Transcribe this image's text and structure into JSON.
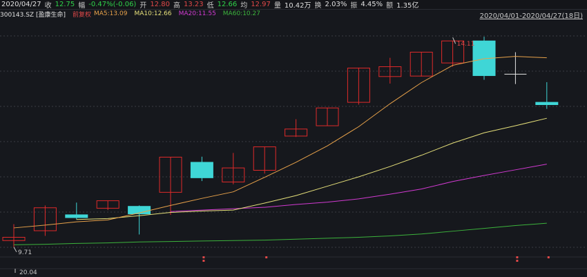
{
  "header": {
    "date": "2020/04/27",
    "close_label": "收",
    "close_value": "12.75",
    "change_label": "幅",
    "change_value": "-0.47%(-0.06)",
    "open_label": "开",
    "open_value": "12.80",
    "high_label": "高",
    "high_value": "13.23",
    "low_label": "低",
    "low_value": "12.66",
    "avg_label": "均",
    "avg_value": "12.97",
    "volume_label": "量",
    "volume_value": "10.42万",
    "turnover_label": "换",
    "turnover_value": "2.03%",
    "amplitude_label": "振",
    "amplitude_value": "4.45%",
    "amount_label": "额",
    "amount_value": "1.35亿",
    "range": "2020/04/01-2020/04/27(18日)"
  },
  "legend": {
    "stock": "300143.SZ [盈康生命]",
    "adjust": "前复权",
    "ma5": "MA5:13.09",
    "ma10": "MA10:12.66",
    "ma20": "MA20:11.55",
    "ma60": "MA60:10.27"
  },
  "colors": {
    "up": "#e02a2a",
    "down": "#3fd6d6",
    "ma5": "#e8a24a",
    "ma10": "#e6e07a",
    "ma20": "#d23ad2",
    "ma60": "#3cb43c",
    "grid": "#3a3d44"
  },
  "chart_data": {
    "type": "candlestick",
    "categories": [
      "20.04"
    ],
    "ylim": [
      9.5,
      14.6
    ],
    "candles": [
      {
        "open": 9.85,
        "close": 9.92,
        "high": 10.2,
        "low": 9.71
      },
      {
        "open": 10.06,
        "close": 10.55,
        "high": 10.6,
        "low": 9.95
      },
      {
        "open": 10.4,
        "close": 10.34,
        "high": 10.66,
        "low": 10.3
      },
      {
        "open": 10.54,
        "close": 10.7,
        "high": 10.7,
        "low": 10.5
      },
      {
        "open": 10.58,
        "close": 10.42,
        "high": 10.6,
        "low": 9.98
      },
      {
        "open": 10.88,
        "close": 11.63,
        "high": 11.63,
        "low": 10.4
      },
      {
        "open": 11.52,
        "close": 11.19,
        "high": 11.64,
        "low": 11.12
      },
      {
        "open": 11.1,
        "close": 11.4,
        "high": 11.72,
        "low": 11.05
      },
      {
        "open": 11.35,
        "close": 11.85,
        "high": 11.85,
        "low": 11.28
      },
      {
        "open": 12.08,
        "close": 12.23,
        "high": 12.44,
        "low": 12.06
      },
      {
        "open": 12.3,
        "close": 12.68,
        "high": 12.68,
        "low": 12.3
      },
      {
        "open": 12.8,
        "close": 13.53,
        "high": 13.54,
        "low": 12.75
      },
      {
        "open": 13.35,
        "close": 13.56,
        "high": 13.75,
        "low": 13.2
      },
      {
        "open": 13.36,
        "close": 13.87,
        "high": 13.87,
        "low": 13.35
      },
      {
        "open": 13.64,
        "close": 14.11,
        "high": 14.11,
        "low": 13.56
      },
      {
        "open": 14.11,
        "close": 13.37,
        "high": 14.2,
        "low": 13.28
      },
      {
        "open": 13.4,
        "close": 13.4,
        "high": 13.87,
        "low": 13.19
      },
      {
        "open": 12.8,
        "close": 12.75,
        "high": 13.23,
        "low": 12.66
      }
    ],
    "ma5": [
      10.12,
      10.18,
      10.25,
      10.29,
      10.44,
      10.6,
      10.75,
      10.89,
      11.2,
      11.52,
      11.87,
      12.28,
      12.77,
      13.22,
      13.59,
      13.73,
      13.78,
      13.75
    ],
    "ma10": [
      null,
      null,
      10.3,
      10.32,
      10.38,
      10.45,
      10.48,
      10.5,
      10.65,
      10.81,
      11.01,
      11.21,
      11.43,
      11.67,
      11.93,
      12.15,
      12.3,
      12.46
    ],
    "ma20": [
      null,
      null,
      null,
      null,
      null,
      10.47,
      10.5,
      10.53,
      10.56,
      10.62,
      10.67,
      10.74,
      10.84,
      10.95,
      11.11,
      11.24,
      11.36,
      11.48
    ],
    "ma60": [
      9.76,
      9.77,
      9.79,
      9.8,
      9.82,
      9.83,
      9.84,
      9.85,
      9.86,
      9.88,
      9.9,
      9.92,
      9.95,
      9.99,
      10.05,
      10.11,
      10.17,
      10.22
    ],
    "annotations": [
      {
        "label": "14.11",
        "index": 14,
        "value": 14.11
      },
      {
        "label": "9.71",
        "index": 0,
        "value": 9.71
      }
    ],
    "event_markers": [
      {
        "index": 6,
        "rows": 2
      },
      {
        "index": 8,
        "rows": 1
      },
      {
        "index": 16,
        "rows": 2
      },
      {
        "index": 17,
        "rows": 1
      }
    ]
  }
}
